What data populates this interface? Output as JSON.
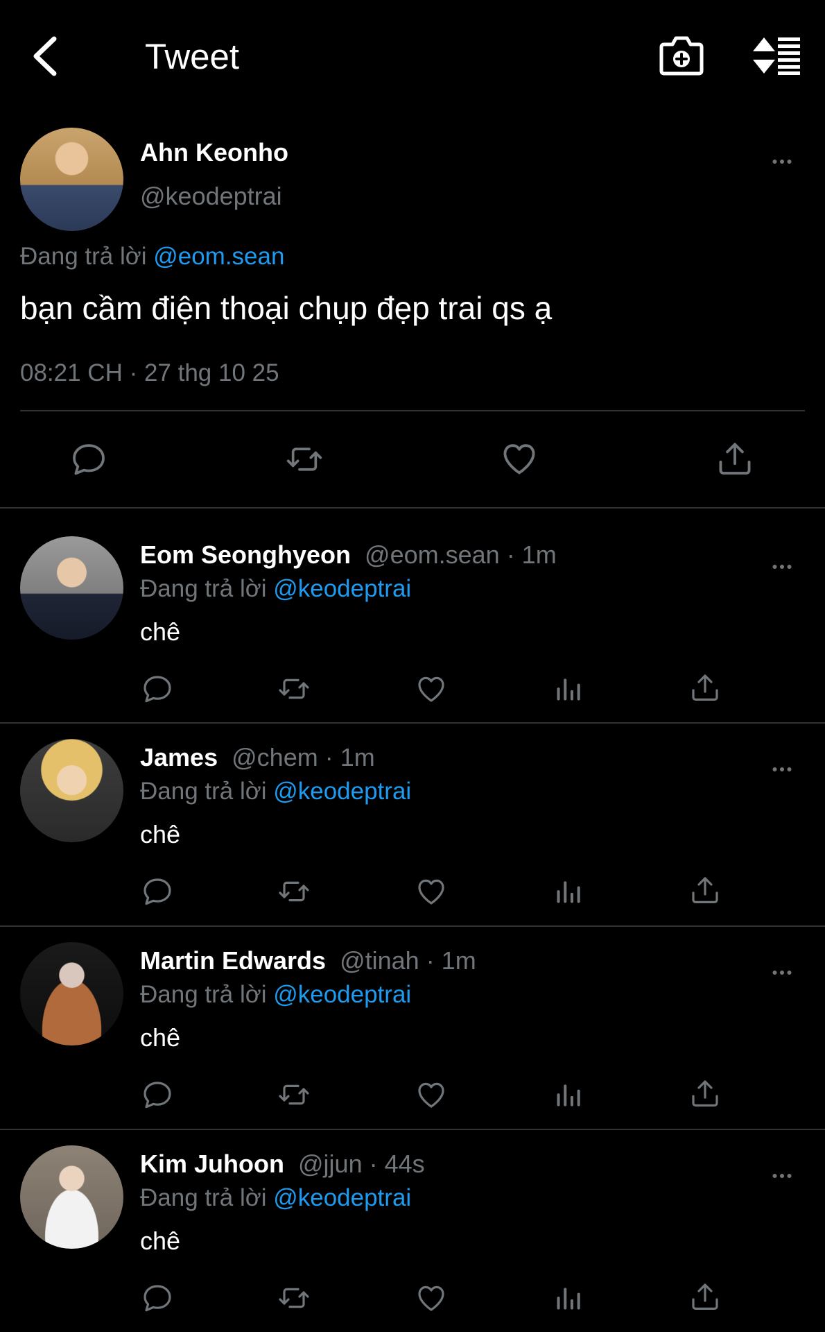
{
  "header": {
    "title": "Tweet"
  },
  "main_tweet": {
    "display_name": "Ahn Keonho",
    "handle": "@keodeptrai",
    "replying_prefix": "Đang trả lời",
    "replying_to": "@eom.sean",
    "text": "bạn cầm điện thoại chụp đẹp trai qs ạ",
    "timestamp": "08:21 CH · 27 thg 10 25"
  },
  "replies": [
    {
      "display_name": "Eom Seonghyeon",
      "meta": "@eom.sean · 1m",
      "replying_prefix": "Đang trả lời",
      "replying_to": "@keodeptrai",
      "text": "chê"
    },
    {
      "display_name": "James",
      "meta": "@chem · 1m",
      "replying_prefix": "Đang trả lời",
      "replying_to": "@keodeptrai",
      "text": "chê"
    },
    {
      "display_name": "Martin Edwards",
      "meta": "@tinah · 1m",
      "replying_prefix": "Đang trả lời",
      "replying_to": "@keodeptrai",
      "text": "chê"
    },
    {
      "display_name": "Kim Juhoon",
      "meta": "@jjun · 44s",
      "replying_prefix": "Đang trả lời",
      "replying_to": "@keodeptrai",
      "text": "chê"
    }
  ],
  "icons": {
    "back": "chevron-left-icon",
    "camera": "camera-plus-icon",
    "sort": "sort-list-icon",
    "more": "more-dots-icon",
    "reply": "speech-bubble-icon",
    "retweet": "retweet-icon",
    "like": "heart-icon",
    "views": "bar-chart-icon",
    "share": "share-upload-icon"
  },
  "colors": {
    "background": "#000000",
    "text": "#e7e9ea",
    "muted": "#71767b",
    "link": "#1d9bf0",
    "divider": "#2f3336"
  }
}
